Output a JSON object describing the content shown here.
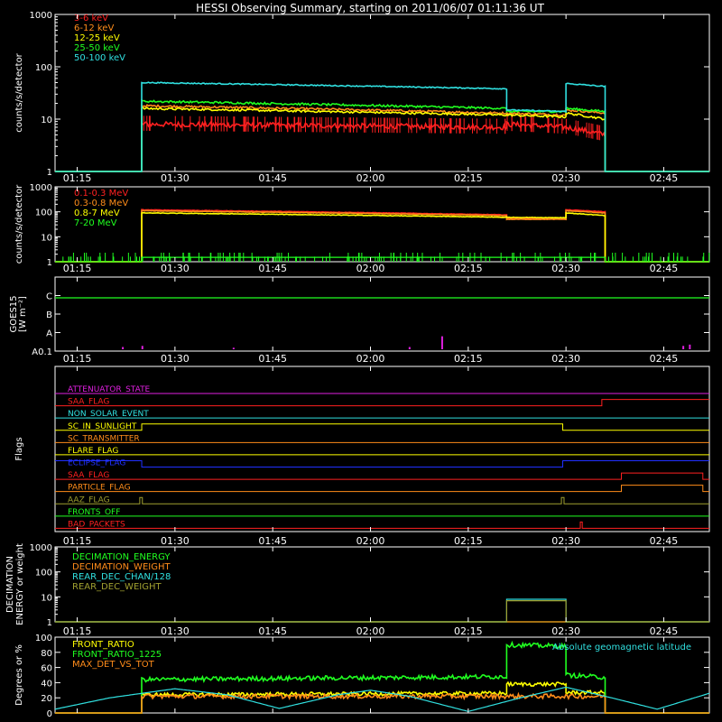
{
  "title": "HESSI Observing Summary, starting on 2011/06/07 01:11:36 UT",
  "time_axis": {
    "start_min": 71.6,
    "end_min": 172,
    "tick_minutes": [
      75,
      90,
      105,
      120,
      135,
      150,
      165
    ],
    "tick_labels": [
      "01:15",
      "01:30",
      "01:45",
      "02:00",
      "02:15",
      "02:30",
      "02:45"
    ]
  },
  "colors": {
    "red": "#ff2020",
    "orange": "#ff8c1a",
    "yellow": "#ffff00",
    "green": "#20ff20",
    "cyan": "#30e0e0",
    "magenta": "#e020e0",
    "blue": "#2030ff",
    "olive": "#a0a030",
    "white": "#ffffff"
  },
  "chart_data": [
    {
      "type": "line",
      "id": "xray_rates",
      "ylabel": "counts/s/detector",
      "yscale": "log",
      "ylim": [
        1,
        1000
      ],
      "yticks": [
        1,
        10,
        100,
        1000
      ],
      "ytick_labels": [
        "1",
        "10",
        "100",
        "1000"
      ],
      "legend_position": "top-left",
      "series": [
        {
          "name": "3-6 keV",
          "color": "red",
          "noise": 0.05,
          "spikes": true,
          "x": [
            71.6,
            84.9,
            84.9,
            140.9,
            140.9,
            150,
            150,
            156,
            156,
            172
          ],
          "y": [
            1,
            1,
            8,
            7,
            8,
            7,
            7,
            5,
            1,
            1
          ]
        },
        {
          "name": "6-12 keV",
          "color": "orange",
          "noise": 0.02,
          "x": [
            71.6,
            84.9,
            84.9,
            140.9,
            140.9,
            150,
            150,
            156,
            156,
            172
          ],
          "y": [
            1,
            1,
            18,
            13,
            13,
            12,
            15,
            13,
            1,
            1
          ]
        },
        {
          "name": "12-25 keV",
          "color": "yellow",
          "noise": 0.02,
          "x": [
            71.6,
            84.9,
            84.9,
            140.9,
            140.9,
            150,
            150,
            156,
            156,
            172
          ],
          "y": [
            1,
            1,
            16,
            12,
            12,
            11,
            13,
            10,
            1,
            1
          ]
        },
        {
          "name": "25-50 keV",
          "color": "green",
          "noise": 0.02,
          "x": [
            71.6,
            84.9,
            84.9,
            140.9,
            140.9,
            150,
            150,
            156,
            156,
            172
          ],
          "y": [
            1,
            1,
            22,
            16,
            14,
            14,
            16,
            14,
            1,
            1
          ]
        },
        {
          "name": "50-100 keV",
          "color": "cyan",
          "noise": 0.01,
          "x": [
            71.6,
            84.9,
            84.9,
            140.9,
            140.9,
            150,
            150,
            156,
            156,
            172
          ],
          "y": [
            1,
            1,
            50,
            38,
            15,
            14,
            48,
            42,
            1,
            1
          ]
        }
      ]
    },
    {
      "type": "line",
      "id": "gamma_rates",
      "ylabel": "counts/s/detector",
      "yscale": "log",
      "ylim": [
        1,
        1000
      ],
      "yticks": [
        1,
        10,
        100,
        1000
      ],
      "ytick_labels": [
        "1",
        "10",
        "100",
        "1000"
      ],
      "legend_position": "top-left",
      "series": [
        {
          "name": "0.1-0.3 MeV",
          "color": "red",
          "noise": 0.01,
          "x": [
            71.6,
            84.9,
            84.9,
            140.9,
            140.9,
            150,
            150,
            156,
            156,
            172
          ],
          "y": [
            1,
            1,
            120,
            75,
            55,
            55,
            120,
            100,
            1,
            1
          ]
        },
        {
          "name": "0.3-0.8 MeV",
          "color": "orange",
          "noise": 0.01,
          "x": [
            71.6,
            84.9,
            84.9,
            140.9,
            140.9,
            150,
            150,
            156,
            156,
            172
          ],
          "y": [
            1,
            1,
            110,
            70,
            50,
            50,
            110,
            90,
            1,
            1
          ]
        },
        {
          "name": "0.8-7 MeV",
          "color": "yellow",
          "noise": 0.01,
          "x": [
            71.6,
            84.9,
            84.9,
            140.9,
            140.9,
            150,
            150,
            156,
            156,
            172
          ],
          "y": [
            1,
            1,
            90,
            60,
            60,
            58,
            90,
            70,
            1,
            1
          ]
        },
        {
          "name": "7-20 MeV",
          "color": "green",
          "noise": 0.0,
          "spikes": true,
          "x": [
            71.6,
            84.9,
            84.9,
            156,
            156,
            172
          ],
          "y": [
            1,
            1,
            1.5,
            1.5,
            1,
            1
          ]
        }
      ]
    },
    {
      "type": "line",
      "id": "goes15",
      "ylabel": "GOES15 [W m⁻²]",
      "ylim": [
        0,
        4
      ],
      "ytick_positions": [
        0,
        1,
        2,
        3,
        4
      ],
      "ytick_labels": [
        "A0.1",
        "A",
        "B",
        "C",
        ""
      ],
      "series": [
        {
          "name": "",
          "color": "green",
          "x": [
            71.6,
            172
          ],
          "y": [
            2.88,
            2.88
          ]
        },
        {
          "name": "",
          "color": "magenta",
          "type": "bars",
          "x": [
            82,
            85,
            99,
            126,
            131,
            168,
            169
          ],
          "y": [
            0.22,
            0.28,
            0.18,
            0.22,
            0.8,
            0.28,
            0.35
          ]
        }
      ]
    },
    {
      "type": "line",
      "id": "flags",
      "ylabel": "Flags",
      "series": [
        {
          "name": "ATTENUATOR_STATE",
          "color": "magenta",
          "x": [
            71.6,
            172
          ],
          "y": [
            0,
            0
          ]
        },
        {
          "name": "SAA_FLAG",
          "color": "red",
          "x": [
            71.6,
            155.5,
            155.5,
            172
          ],
          "y": [
            0,
            0,
            1,
            1
          ]
        },
        {
          "name": "NON_SOLAR_EVENT",
          "color": "cyan",
          "x": [
            71.6,
            172
          ],
          "y": [
            0,
            0
          ]
        },
        {
          "name": "SC_IN_SUNLIGHT",
          "color": "yellow",
          "x": [
            71.6,
            84.9,
            84.9,
            149.5,
            149.5,
            172
          ],
          "y": [
            0,
            0,
            1,
            1,
            0,
            0
          ]
        },
        {
          "name": "SC_TRANSMITTER",
          "color": "orange",
          "x": [
            71.6,
            172
          ],
          "y": [
            0,
            0
          ]
        },
        {
          "name": "FLARE_FLAG",
          "color": "yellow",
          "x": [
            71.6,
            172
          ],
          "y": [
            0,
            0
          ]
        },
        {
          "name": "ECLIPSE_FLAG",
          "color": "blue",
          "x": [
            71.6,
            84.9,
            84.9,
            149.5,
            149.5,
            172
          ],
          "y": [
            1,
            1,
            0,
            0,
            1,
            1
          ]
        },
        {
          "name": "SAA_FLAG",
          "color": "red",
          "x": [
            71.6,
            158.5,
            158.5,
            171,
            171,
            172
          ],
          "y": [
            0,
            0,
            1,
            1,
            0,
            0
          ]
        },
        {
          "name": "PARTICLE_FLAG",
          "color": "orange",
          "x": [
            71.6,
            158.5,
            158.5,
            171,
            171,
            172
          ],
          "y": [
            0,
            0,
            1,
            1,
            0,
            0
          ]
        },
        {
          "name": "AAZ_FLAG",
          "color": "olive",
          "x": [
            71.6,
            84.6,
            84.6,
            85,
            85,
            149.3,
            149.3,
            149.7,
            149.7,
            172
          ],
          "y": [
            0,
            0,
            1,
            1,
            0,
            0,
            1,
            1,
            0,
            0
          ]
        },
        {
          "name": "FRONTS_OFF",
          "color": "green",
          "x": [
            71.6,
            172
          ],
          "y": [
            0,
            0
          ]
        },
        {
          "name": "BAD_PACKETS",
          "color": "red",
          "x": [
            71.6,
            152.2,
            152.2,
            152.5,
            152.5,
            172
          ],
          "y": [
            0,
            0,
            1,
            1,
            0,
            0
          ]
        }
      ]
    },
    {
      "type": "line",
      "id": "decimation",
      "ylabel": "DECIMATION ENERGY or weight",
      "yscale": "log",
      "ylim": [
        1,
        1000
      ],
      "yticks": [
        1,
        10,
        100,
        1000
      ],
      "ytick_labels": [
        "1",
        "10",
        "100",
        "1000"
      ],
      "legend_position": "top-left",
      "series": [
        {
          "name": "DECIMATION_ENERGY",
          "color": "green",
          "x": [
            71.6,
            172
          ],
          "y": [
            1,
            1
          ]
        },
        {
          "name": "DECIMATION_WEIGHT",
          "color": "orange",
          "x": [
            71.6,
            172
          ],
          "y": [
            1,
            1
          ]
        },
        {
          "name": "REAR_DEC_CHAN/128",
          "color": "cyan",
          "x": [
            71.6,
            140.9,
            140.9,
            150,
            150,
            172
          ],
          "y": [
            1,
            1,
            8,
            8,
            1,
            1
          ]
        },
        {
          "name": "REAR_DEC_WEIGHT",
          "color": "olive",
          "x": [
            71.6,
            140.9,
            140.9,
            150,
            150,
            172
          ],
          "y": [
            1,
            1,
            7,
            7,
            1,
            1
          ]
        }
      ]
    },
    {
      "type": "line",
      "id": "ratios",
      "ylabel": "Degrees or %",
      "ylim": [
        0,
        100
      ],
      "yticks": [
        0,
        20,
        40,
        60,
        80,
        100
      ],
      "ytick_labels": [
        "0",
        "20",
        "40",
        "60",
        "80",
        "100"
      ],
      "legend_position": "top-left",
      "annotation": "Absolute geomagnetic latitude",
      "series": [
        {
          "name": "FRONT_RATIO",
          "color": "yellow",
          "noise": 2.5,
          "x": [
            71.6,
            84.9,
            84.9,
            140.9,
            140.9,
            150,
            150,
            156,
            156,
            172
          ],
          "y": [
            0,
            0,
            24,
            26,
            38,
            38,
            27,
            27,
            0,
            0
          ]
        },
        {
          "name": "FRONT_RATIO_1225",
          "color": "green",
          "noise": 3,
          "x": [
            71.6,
            84.9,
            84.9,
            140.9,
            140.9,
            150,
            150,
            156,
            156,
            172
          ],
          "y": [
            0,
            0,
            44,
            48,
            90,
            88,
            50,
            47,
            0,
            0
          ]
        },
        {
          "name": "MAX_DET_VS_TOT",
          "color": "orange",
          "noise": 3,
          "x": [
            71.6,
            84.9,
            84.9,
            156,
            156,
            172
          ],
          "y": [
            0,
            0,
            22,
            22,
            0,
            0
          ]
        },
        {
          "name": "",
          "color": "cyan",
          "x": [
            71.6,
            80,
            90,
            98,
            106,
            115,
            120,
            126,
            135,
            143,
            150,
            157,
            164,
            172
          ],
          "y": [
            5,
            20,
            32,
            24,
            6,
            24,
            30,
            22,
            2,
            20,
            34,
            20,
            5,
            26
          ]
        }
      ]
    }
  ]
}
